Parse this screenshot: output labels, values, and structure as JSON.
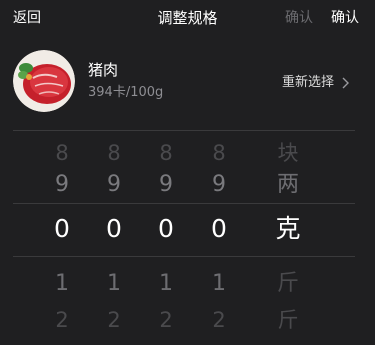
{
  "header": {
    "back_label": "返回",
    "title": "调整规格",
    "confirm_dim_label": "确认",
    "confirm_label": "确认"
  },
  "food": {
    "name": "猪肉",
    "calorie": "394卡/100g",
    "reselect_label": "重新选择",
    "image_icon": "meat-image"
  },
  "picker": {
    "rows": [
      {
        "digits": [
          "8",
          "8",
          "8",
          "8"
        ],
        "unit": "块"
      },
      {
        "digits": [
          "9",
          "9",
          "9",
          "9"
        ],
        "unit": "两"
      },
      {
        "digits": [
          "0",
          "0",
          "0",
          "0"
        ],
        "unit": "克"
      },
      {
        "digits": [
          "1",
          "1",
          "1",
          "1"
        ],
        "unit": "斤"
      },
      {
        "digits": [
          "2",
          "2",
          "2",
          "2"
        ],
        "unit": "斤"
      }
    ],
    "selected_row": 2
  },
  "colors": {
    "background": "#1f1f21",
    "text": "#ffffff",
    "muted": "#8e8e93",
    "divider": "#3a3a3c"
  }
}
